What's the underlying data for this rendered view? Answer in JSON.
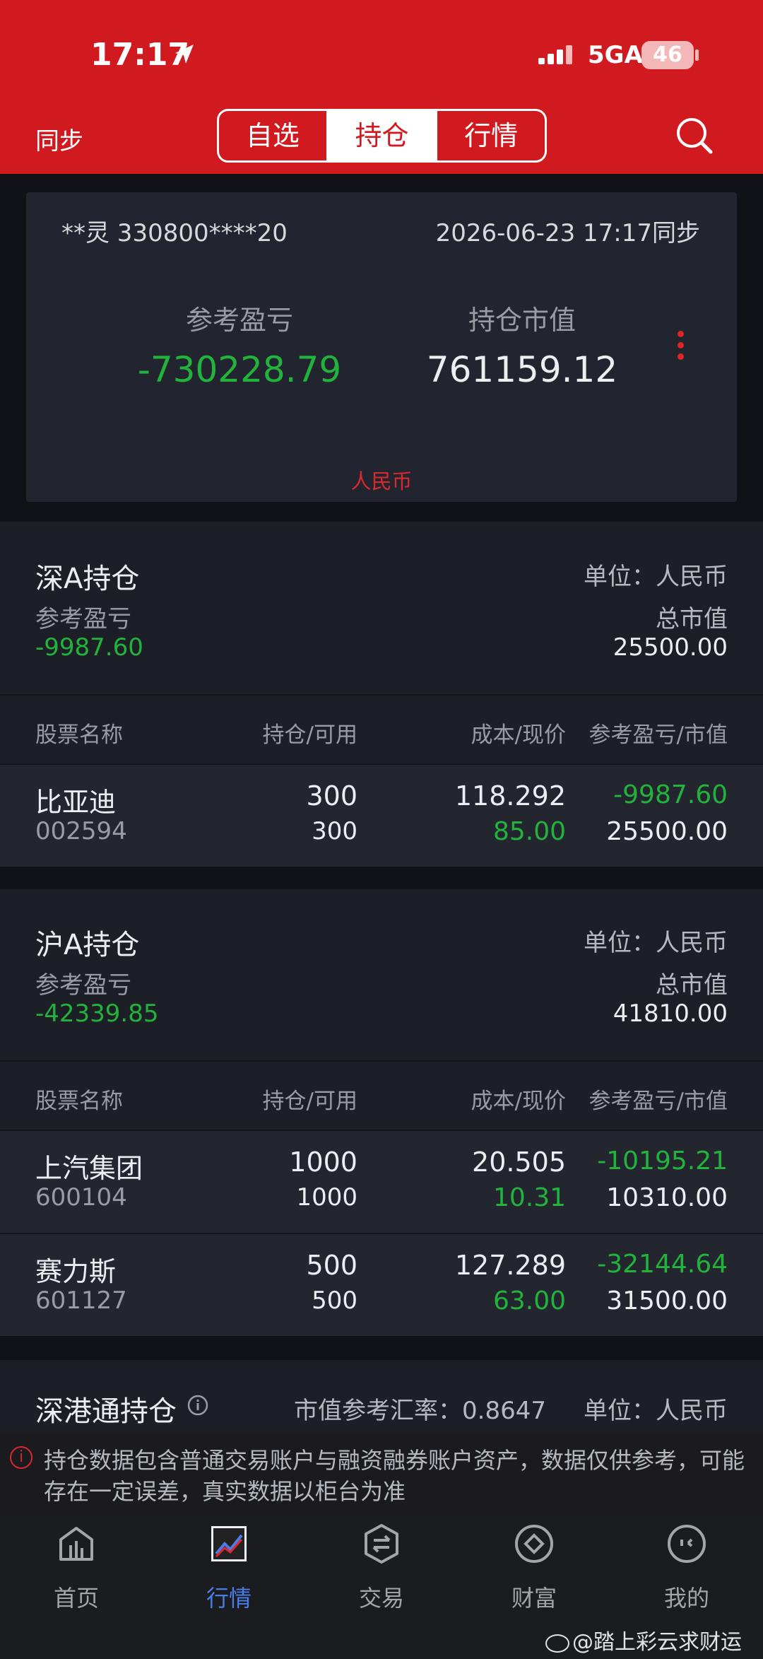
{
  "status": {
    "time": "17:17",
    "network": "5GA",
    "battery": "46"
  },
  "header": {
    "sync_label": "同步",
    "tabs": [
      {
        "label": "自选"
      },
      {
        "label": "持仓"
      },
      {
        "label": "行情"
      }
    ],
    "active_tab": "持仓"
  },
  "summary": {
    "account": "**灵 330800****20",
    "sync_time": "2026-06-23 17:17同步",
    "pl_label": "参考盈亏",
    "pl_value": "-730228.79",
    "mv_label": "持仓市值",
    "mv_value": "761159.12",
    "currency": "人民币"
  },
  "columns": {
    "name": "股票名称",
    "hold": "持仓/可用",
    "cost": "成本/现价",
    "pl": "参考盈亏/市值"
  },
  "sections": [
    {
      "title": "深A持仓",
      "unit": "单位：人民币",
      "pl_label": "参考盈亏",
      "mv_label": "总市值",
      "pl_value": "-9987.60",
      "mv_value": "25500.00",
      "rows": [
        {
          "name": "比亚迪",
          "code": "002594",
          "hold": "300",
          "avail": "300",
          "cost": "118.292",
          "price": "85.00",
          "pl": "-9987.60",
          "mv": "25500.00"
        }
      ]
    },
    {
      "title": "沪A持仓",
      "unit": "单位：人民币",
      "pl_label": "参考盈亏",
      "mv_label": "总市值",
      "pl_value": "-42339.85",
      "mv_value": "41810.00",
      "rows": [
        {
          "name": "上汽集团",
          "code": "600104",
          "hold": "1000",
          "avail": "1000",
          "cost": "20.505",
          "price": "10.31",
          "pl": "-10195.21",
          "mv": "10310.00"
        },
        {
          "name": "赛力斯",
          "code": "601127",
          "hold": "500",
          "avail": "500",
          "cost": "127.289",
          "price": "63.00",
          "pl": "-32144.64",
          "mv": "31500.00"
        }
      ]
    },
    {
      "title": "深港通持仓",
      "rate_text": "市值参考汇率：0.8647",
      "unit": "单位：人民币"
    }
  ],
  "notice": "持仓数据包含普通交易账户与融资融券账户资产，数据仅供参考，可能存在一定误差，真实数据以柜台为准",
  "tabbar": [
    {
      "label": "首页",
      "icon": "home-icon"
    },
    {
      "label": "行情",
      "icon": "market-chart-icon"
    },
    {
      "label": "交易",
      "icon": "trade-icon"
    },
    {
      "label": "财富",
      "icon": "wealth-icon"
    },
    {
      "label": "我的",
      "icon": "profile-icon"
    }
  ],
  "watermark": "@踏上彩云求财运",
  "colors": {
    "brand_red": "#d11a1f",
    "loss_green": "#21b33b",
    "active_blue": "#4a7de8"
  }
}
